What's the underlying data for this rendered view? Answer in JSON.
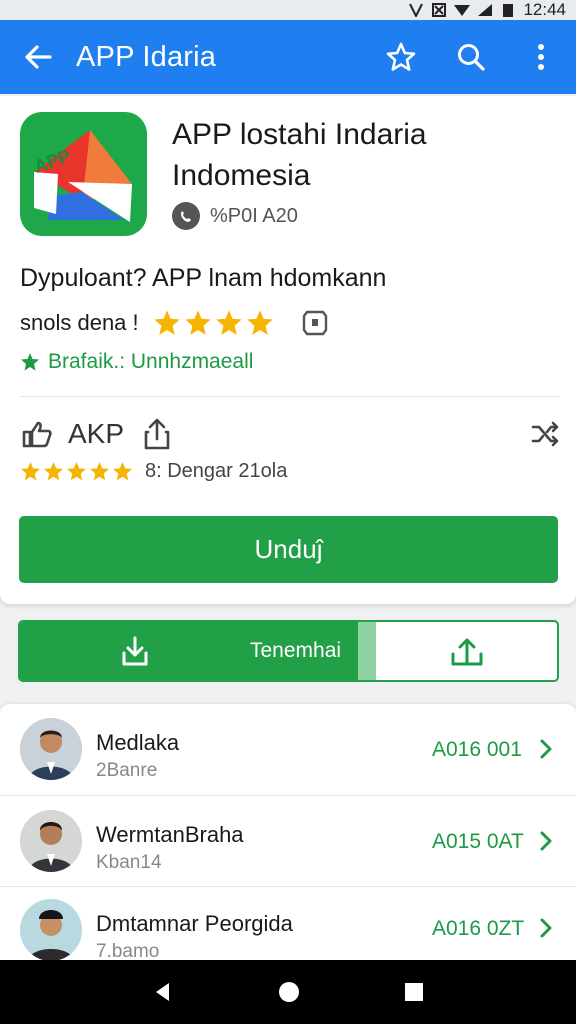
{
  "status_bar": {
    "time": "12:44"
  },
  "app_bar": {
    "title": "APP Idaria",
    "icons": [
      "back-arrow-icon",
      "star-outline-icon",
      "search-icon",
      "more-vert-icon"
    ]
  },
  "app": {
    "title_line1": "APP lostahi Indaria",
    "title_line2": "Indomesia",
    "developer": "%P0I A20",
    "description": "Dypuloant? APP lnam hdomkann",
    "rating_label": "snols dena !",
    "rating_stars": 4,
    "category": "Brafaik.: Unnhzmaeall",
    "meta_label": "AKP",
    "review_text": "8: Dengar 21ola",
    "review_stars": 5,
    "install_button": "Unduĵ"
  },
  "split_button": {
    "label": "Tenemhai"
  },
  "list": [
    {
      "name": "Medlaka",
      "sub": "2Banre",
      "date": "A016 001"
    },
    {
      "name": "WermtanBraha",
      "sub": "Kban14",
      "date": "A015 0AT"
    },
    {
      "name": "Dmtamnar Peorgida",
      "sub": "7.bamo",
      "date": "A016 0ZT"
    }
  ],
  "colors": {
    "app_bar": "#1f7ff0",
    "accent_green": "#22a048",
    "star": "#f5b400"
  }
}
